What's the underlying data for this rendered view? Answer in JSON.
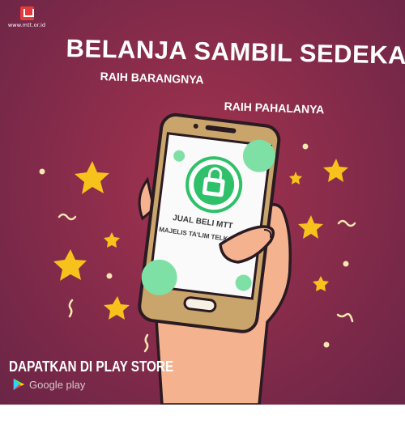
{
  "logo": {
    "url": "www.mtt.or.id"
  },
  "headline": "BELANJA SAMBIL SEDEKAH",
  "sub_line_1": "RAIH BARANGNYA",
  "sub_line_2": "RAIH PAHALANYA",
  "phone_screen": {
    "line_1": "JUAL BELI MTT",
    "line_2": "MAJELIS TA'LIM TELK"
  },
  "cta": "DAPATKAN DI PLAY STORE",
  "store_badge": {
    "label": "Google play",
    "icon": "google-play-icon"
  },
  "colors": {
    "background": "#8a2c4b",
    "phone_gold": "#c9a46b",
    "accent_green": "#2fc06a",
    "star_yellow": "#f7c21c",
    "hand": "#f4b28f"
  }
}
